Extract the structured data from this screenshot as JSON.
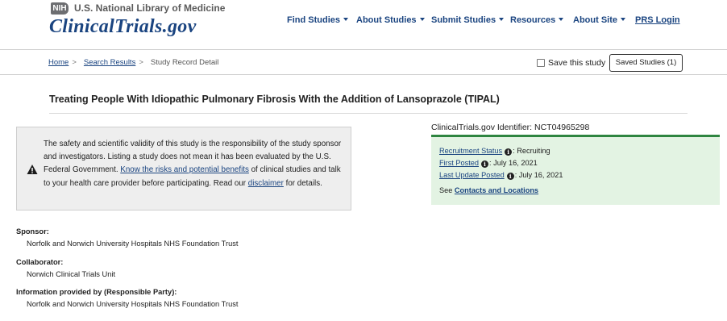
{
  "header": {
    "nih_badge": "NIH",
    "library_name": "U.S. National Library of Medicine",
    "site_name": "ClinicalTrials.gov",
    "nav": {
      "find_studies": "Find Studies",
      "about_studies": "About Studies",
      "submit_studies": "Submit Studies",
      "resources": "Resources",
      "about_site": "About Site",
      "prs_login": "PRS Login"
    }
  },
  "breadcrumb": {
    "home": "Home",
    "search_results": "Search Results",
    "current": "Study Record Detail",
    "separator": ">"
  },
  "actions": {
    "save_label": "Save this study",
    "save_checked": false,
    "saved_studies": "Saved Studies (1)"
  },
  "study": {
    "title": "Treating People With Idiopathic Pulmonary Fibrosis With the Addition of Lansoprazole (TIPAL)"
  },
  "disclaimer": {
    "part1": "The safety and scientific validity of this study is the responsibility of the study sponsor and investigators. Listing a study does not mean it has been evaluated by the U.S. Federal Government. ",
    "risks_link": "Know the risks and potential benefits",
    "part2": " of clinical studies and talk to your health care provider before participating. Read our ",
    "disclaimer_link": "disclaimer",
    "part3": " for details."
  },
  "status": {
    "identifier_label": "ClinicalTrials.gov Identifier: ",
    "identifier": "NCT04965298",
    "recruitment_label": "Recruitment Status",
    "recruitment_value": ": Recruiting",
    "first_posted_label": "First Posted",
    "first_posted_value": ": July 16, 2021",
    "last_update_label": "Last Update Posted",
    "last_update_value": ": July 16, 2021",
    "see_prefix": "See ",
    "contacts_link": "Contacts and Locations",
    "info_glyph": "i"
  },
  "details": {
    "sponsor_label": "Sponsor:",
    "sponsor_value": "Norfolk and Norwich University Hospitals NHS Foundation Trust",
    "collaborator_label": "Collaborator:",
    "collaborator_value": "Norwich Clinical Trials Unit",
    "responsible_label": "Information provided by (Responsible Party):",
    "responsible_value": "Norfolk and Norwich University Hospitals NHS Foundation Trust"
  },
  "colors": {
    "link_blue": "#1a4480",
    "status_green": "#2e8540",
    "status_bg": "#e3f3e3",
    "disclaimer_bg": "#eeeeee"
  }
}
